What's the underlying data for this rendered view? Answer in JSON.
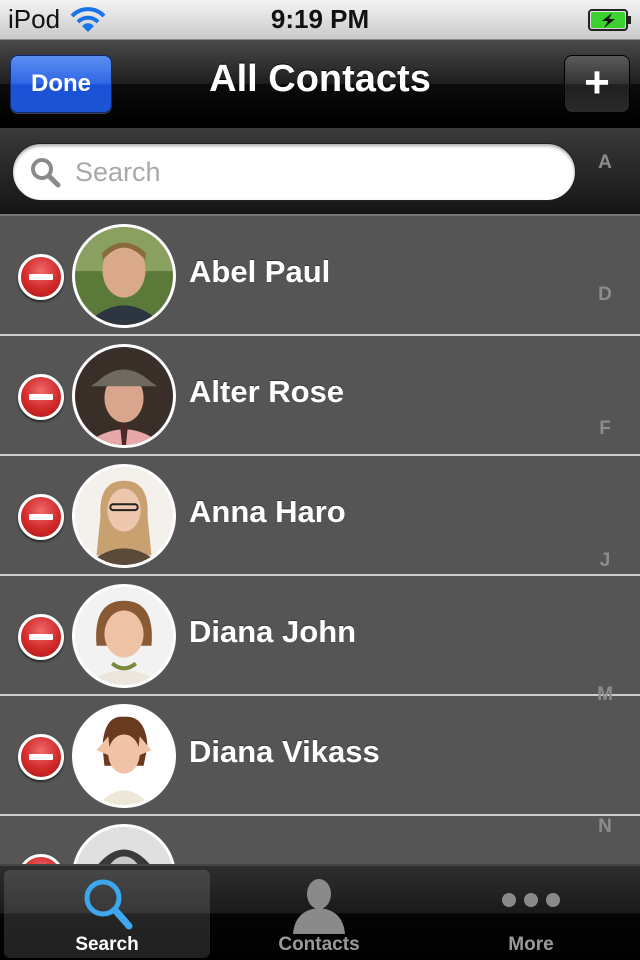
{
  "status_bar": {
    "carrier": "iPod",
    "time": "9:19 PM",
    "wifi_icon": "wifi-icon",
    "battery_icon": "battery-charging-icon"
  },
  "nav_bar": {
    "title": "All Contacts",
    "done_label": "Done",
    "add_label": "+"
  },
  "search": {
    "placeholder": "Search",
    "value": ""
  },
  "contacts": [
    {
      "name": "Abel Paul"
    },
    {
      "name": "Alter Rose"
    },
    {
      "name": "Anna Haro"
    },
    {
      "name": "Diana John"
    },
    {
      "name": "Diana Vikass"
    },
    {
      "name": ""
    }
  ],
  "section_index": [
    "A",
    "D",
    "F",
    "J",
    "M",
    "N"
  ],
  "tab_bar": {
    "tabs": [
      {
        "label": "Search",
        "icon": "search-icon",
        "selected": true
      },
      {
        "label": "Contacts",
        "icon": "person-icon",
        "selected": false
      },
      {
        "label": "More",
        "icon": "more-dots-icon",
        "selected": false
      }
    ]
  },
  "colors": {
    "done_button": "#2e66e4",
    "delete_button": "#d12a2a",
    "row_background": "#555555",
    "search_tab_icon": "#3da7f0"
  }
}
